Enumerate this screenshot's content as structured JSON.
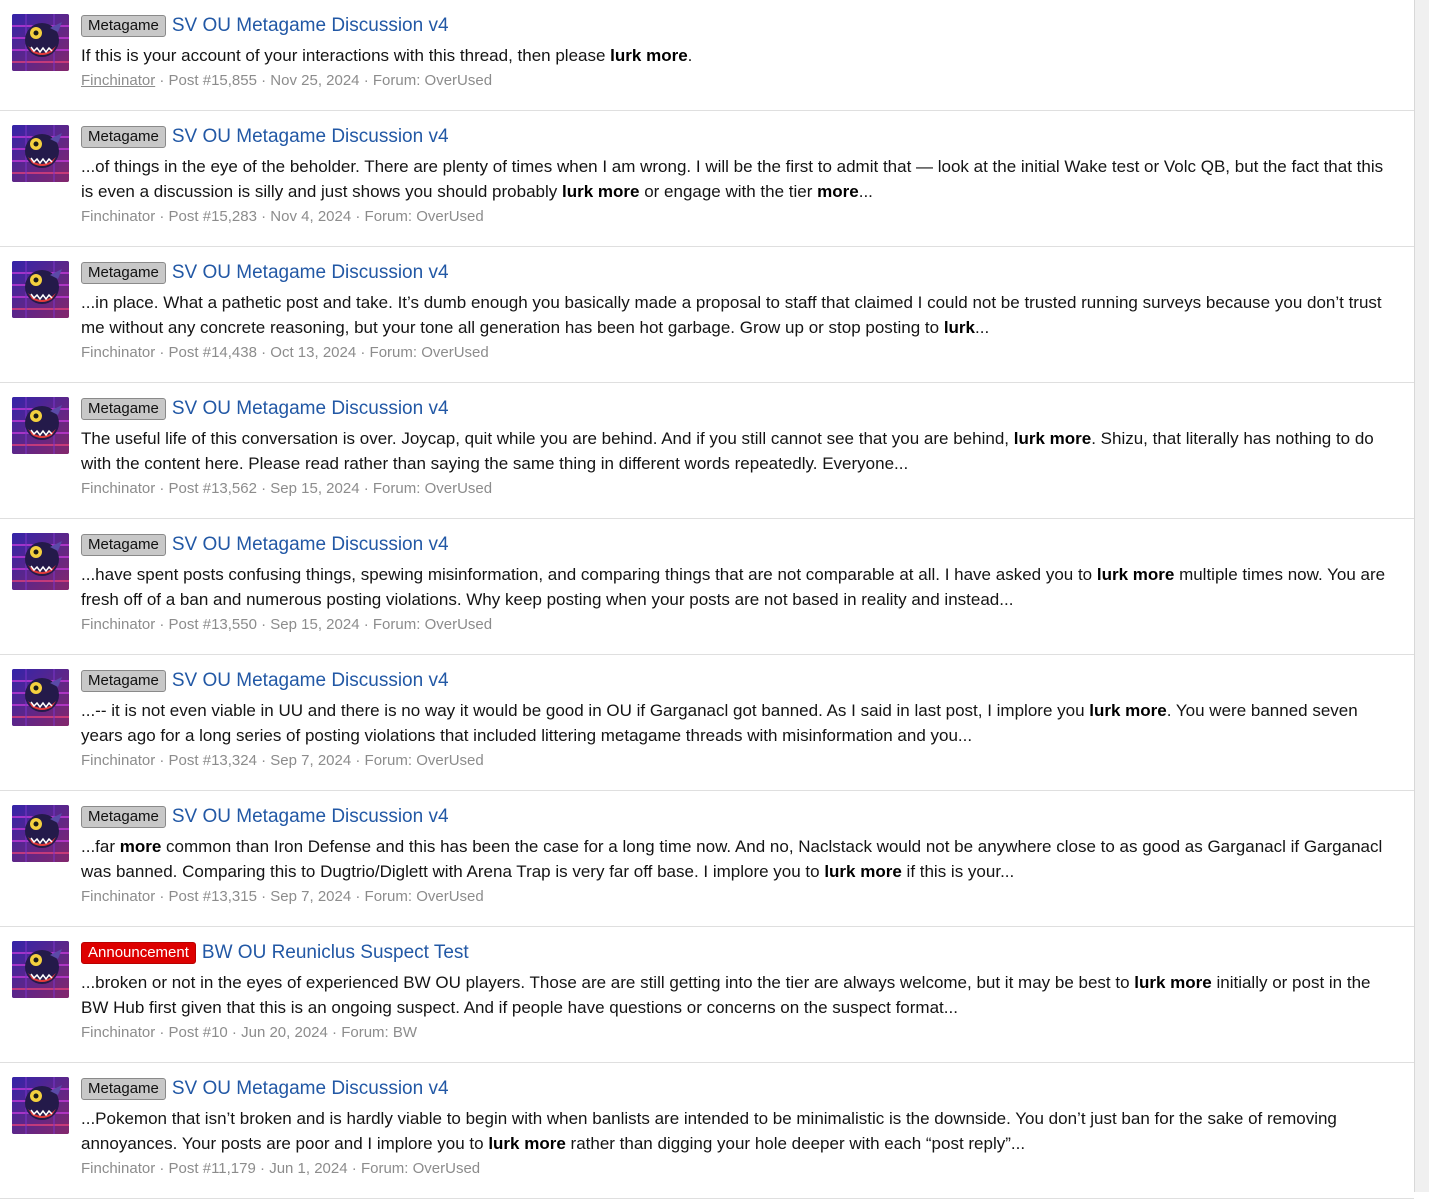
{
  "results": [
    {
      "label": "Metagame",
      "label_style": "gray",
      "thread": "SV OU Metagame Discussion v4",
      "snippet": [
        {
          "t": "If this is your account of your interactions with this thread, then please "
        },
        {
          "t": "lurk more",
          "b": true
        },
        {
          "t": "."
        }
      ],
      "user": "Finchinator",
      "post": "Post #15,855",
      "date": "Nov 25, 2024",
      "forum": "Forum: OverUsed"
    },
    {
      "label": "Metagame",
      "label_style": "gray",
      "thread": "SV OU Metagame Discussion v4",
      "snippet": [
        {
          "t": "...of things in the eye of the beholder. There are plenty of times when I am wrong. I will be the first to admit that — look at the initial Wake test or Volc QB, but the fact that this is even a discussion is silly and just shows you should probably "
        },
        {
          "t": "lurk more",
          "b": true
        },
        {
          "t": " or engage with the tier "
        },
        {
          "t": "more",
          "b": true
        },
        {
          "t": "..."
        }
      ],
      "user": "Finchinator",
      "post": "Post #15,283",
      "date": "Nov 4, 2024",
      "forum": "Forum: OverUsed"
    },
    {
      "label": "Metagame",
      "label_style": "gray",
      "thread": "SV OU Metagame Discussion v4",
      "snippet": [
        {
          "t": "...in place. What a pathetic post and take. It’s dumb enough you basically made a proposal to staff that claimed I could not be trusted running surveys because you don’t trust me without any concrete reasoning, but your tone all generation has been hot garbage. Grow up or stop posting to "
        },
        {
          "t": "lurk",
          "b": true
        },
        {
          "t": "..."
        }
      ],
      "user": "Finchinator",
      "post": "Post #14,438",
      "date": "Oct 13, 2024",
      "forum": "Forum: OverUsed"
    },
    {
      "label": "Metagame",
      "label_style": "gray",
      "thread": "SV OU Metagame Discussion v4",
      "snippet": [
        {
          "t": "The useful life of this conversation is over. Joycap, quit while you are behind. And if you still cannot see that you are behind, "
        },
        {
          "t": "lurk more",
          "b": true
        },
        {
          "t": ". Shizu, that literally has nothing to do with the content here. Please read rather than saying the same thing in different words repeatedly. Everyone..."
        }
      ],
      "user": "Finchinator",
      "post": "Post #13,562",
      "date": "Sep 15, 2024",
      "forum": "Forum: OverUsed"
    },
    {
      "label": "Metagame",
      "label_style": "gray",
      "thread": "SV OU Metagame Discussion v4",
      "snippet": [
        {
          "t": "...have spent posts confusing things, spewing misinformation, and comparing things that are not comparable at all. I have asked you to "
        },
        {
          "t": "lurk more",
          "b": true
        },
        {
          "t": " multiple times now. You are fresh off of a ban and numerous posting violations. Why keep posting when your posts are not based in reality and instead..."
        }
      ],
      "user": "Finchinator",
      "post": "Post #13,550",
      "date": "Sep 15, 2024",
      "forum": "Forum: OverUsed"
    },
    {
      "label": "Metagame",
      "label_style": "gray",
      "thread": "SV OU Metagame Discussion v4",
      "snippet": [
        {
          "t": "...-- it is not even viable in UU and there is no way it would be good in OU if Garganacl got banned. As I said in last post, I implore you "
        },
        {
          "t": "lurk more",
          "b": true
        },
        {
          "t": ". You were banned seven years ago for a long series of posting violations that included littering metagame threads with misinformation and you..."
        }
      ],
      "user": "Finchinator",
      "post": "Post #13,324",
      "date": "Sep 7, 2024",
      "forum": "Forum: OverUsed"
    },
    {
      "label": "Metagame",
      "label_style": "gray",
      "thread": "SV OU Metagame Discussion v4",
      "snippet": [
        {
          "t": "...far "
        },
        {
          "t": "more",
          "b": true
        },
        {
          "t": " common than Iron Defense and this has been the case for a long time now. And no, Naclstack would not be anywhere close to as good as Garganacl if Garganacl was banned. Comparing this to Dugtrio/Diglett with Arena Trap is very far off base. I implore you to "
        },
        {
          "t": "lurk more",
          "b": true
        },
        {
          "t": " if this is your..."
        }
      ],
      "user": "Finchinator",
      "post": "Post #13,315",
      "date": "Sep 7, 2024",
      "forum": "Forum: OverUsed"
    },
    {
      "label": "Announcement",
      "label_style": "red",
      "thread": "BW OU Reuniclus Suspect Test",
      "snippet": [
        {
          "t": "...broken or not in the eyes of experienced BW OU players. Those are are still getting into the tier are always welcome, but it may be best to "
        },
        {
          "t": "lurk more",
          "b": true
        },
        {
          "t": " initially or post in the BW Hub first given that this is an ongoing suspect. And if people have questions or concerns on the suspect format..."
        }
      ],
      "user": "Finchinator",
      "post": "Post #10",
      "date": "Jun 20, 2024",
      "forum": "Forum: BW"
    },
    {
      "label": "Metagame",
      "label_style": "gray",
      "thread": "SV OU Metagame Discussion v4",
      "snippet": [
        {
          "t": "...Pokemon that isn’t broken and is hardly viable to begin with when banlists are intended to be minimalistic is the downside. You don’t just ban for the sake of removing annoyances. Your posts are poor and I implore you to "
        },
        {
          "t": "lurk more",
          "b": true
        },
        {
          "t": " rather than digging your hole deeper with each “post reply”..."
        }
      ],
      "user": "Finchinator",
      "post": "Post #11,179",
      "date": "Jun 1, 2024",
      "forum": "Forum: OverUsed"
    }
  ],
  "meta_separator": " · ",
  "colors": {
    "link": "#2258a5",
    "label_gray_bg": "#c8c8c8",
    "label_red_bg": "#dd0000",
    "meta_text": "#8c8c8c",
    "divider": "#dfdfdf"
  },
  "icons": {
    "avatar": "avatar-icon"
  }
}
